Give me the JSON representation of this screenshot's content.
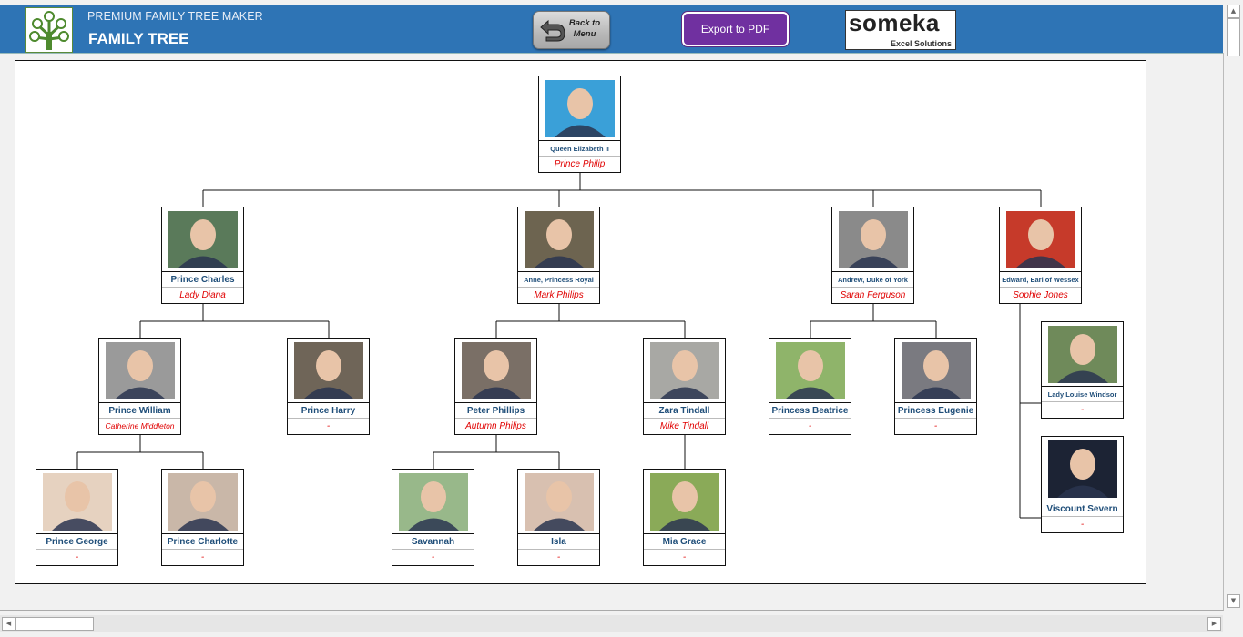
{
  "header": {
    "subtitle": "PREMIUM FAMILY TREE MAKER",
    "title": "FAMILY TREE",
    "back_button": "Back to Menu",
    "back_line1": "Back to",
    "back_line2": "Menu",
    "export_button": "Export to PDF",
    "brand_name": "someka",
    "brand_tagline": "Excel Solutions",
    "colors": {
      "header_bg": "#2e74b5",
      "export_bg": "#7030a0",
      "name_text": "#1f4e79",
      "spouse_text": "#e00000"
    }
  },
  "tree": {
    "root": {
      "name": "Queen Elizabeth II",
      "spouse": "Prince Philip",
      "photo": "#3aa0d8"
    },
    "children": [
      {
        "name": "Prince Charles",
        "spouse": "Lady Diana",
        "photo": "#5a7a5a"
      },
      {
        "name": "Anne, Princess Royal",
        "spouse": "Mark Philips",
        "photo": "#6d6450"
      },
      {
        "name": "Andrew, Duke of York",
        "spouse": "Sarah Ferguson",
        "photo": "#8a8a8a"
      },
      {
        "name": "Edward, Earl of Wessex",
        "spouse": "Sophie Jones",
        "photo": "#c63a2a"
      }
    ],
    "grandchildren": [
      {
        "name": "Prince William",
        "spouse": "Catherine Middleton",
        "photo": "#9a9a9a"
      },
      {
        "name": "Prince Harry",
        "spouse": "-",
        "photo": "#6f6558"
      },
      {
        "name": "Peter Phillips",
        "spouse": "Autumn Philips",
        "photo": "#7a6f66"
      },
      {
        "name": "Zara Tindall",
        "spouse": "Mike Tindall",
        "photo": "#a8a8a4"
      },
      {
        "name": "Princess Beatrice",
        "spouse": "-",
        "photo": "#8fb46a"
      },
      {
        "name": "Princess Eugenie",
        "spouse": "-",
        "photo": "#7a7a80"
      },
      {
        "name": "Lady Louise Windsor",
        "spouse": "-",
        "photo": "#6f8a5a"
      },
      {
        "name": "Viscount Severn",
        "spouse": "-",
        "photo": "#1c2334"
      }
    ],
    "great_grandchildren": [
      {
        "name": "Prince George",
        "spouse": "-",
        "photo": "#e6d2c0"
      },
      {
        "name": "Prince Charlotte",
        "spouse": "-",
        "photo": "#c9b7a8"
      },
      {
        "name": "Savannah",
        "spouse": "-",
        "photo": "#98b88a"
      },
      {
        "name": "Isla",
        "spouse": "-",
        "photo": "#d8c0b0"
      },
      {
        "name": "Mia Grace",
        "spouse": "-",
        "photo": "#8aaa58"
      }
    ]
  }
}
